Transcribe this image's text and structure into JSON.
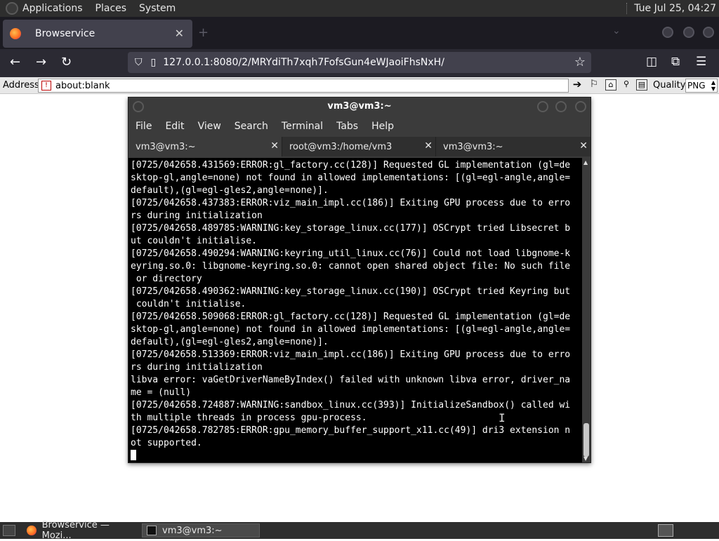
{
  "top_panel": {
    "menus": [
      "Applications",
      "Places",
      "System"
    ],
    "clock": "Tue Jul 25, 04:27"
  },
  "browser": {
    "tab_title": "Browservice",
    "url": "127.0.0.1:8080/2/MRYdiTh7xqh7FofsGun4eWJaoiFhsNxH/",
    "new_tab": "+",
    "tab_list": "⌄"
  },
  "browservice": {
    "address_label": "Address",
    "address_value": "about:blank",
    "quality_label": "Quality",
    "quality_value": "PNG"
  },
  "terminal": {
    "title": "vm3@vm3:~",
    "menu": [
      "File",
      "Edit",
      "View",
      "Search",
      "Terminal",
      "Tabs",
      "Help"
    ],
    "tabs": [
      {
        "label": "vm3@vm3:~"
      },
      {
        "label": "root@vm3:/home/vm3"
      },
      {
        "label": "vm3@vm3:~"
      }
    ],
    "lines": [
      "[0725/042658.431569:ERROR:gl_factory.cc(128)] Requested GL implementation (gl=de",
      "sktop-gl,angle=none) not found in allowed implementations: [(gl=egl-angle,angle=",
      "default),(gl=egl-gles2,angle=none)].",
      "[0725/042658.437383:ERROR:viz_main_impl.cc(186)] Exiting GPU process due to erro",
      "rs during initialization",
      "[0725/042658.489785:WARNING:key_storage_linux.cc(177)] OSCrypt tried Libsecret b",
      "ut couldn't initialise.",
      "[0725/042658.490294:WARNING:keyring_util_linux.cc(76)] Could not load libgnome-k",
      "eyring.so.0: libgnome-keyring.so.0: cannot open shared object file: No such file",
      " or directory",
      "[0725/042658.490362:WARNING:key_storage_linux.cc(190)] OSCrypt tried Keyring but",
      " couldn't initialise.",
      "[0725/042658.509068:ERROR:gl_factory.cc(128)] Requested GL implementation (gl=de",
      "sktop-gl,angle=none) not found in allowed implementations: [(gl=egl-angle,angle=",
      "default),(gl=egl-gles2,angle=none)].",
      "[0725/042658.513369:ERROR:viz_main_impl.cc(186)] Exiting GPU process due to erro",
      "rs during initialization",
      "libva error: vaGetDriverNameByIndex() failed with unknown libva error, driver_na",
      "me = (null)",
      "[0725/042658.724887:WARNING:sandbox_linux.cc(393)] InitializeSandbox() called wi",
      "th multiple threads in process gpu-process.",
      "[0725/042658.782785:ERROR:gpu_memory_buffer_support_x11.cc(49)] dri3 extension n",
      "ot supported."
    ]
  },
  "taskbar": {
    "tasks": [
      {
        "label": "Browservice — Mozi..."
      },
      {
        "label": "vm3@vm3:~"
      }
    ]
  }
}
